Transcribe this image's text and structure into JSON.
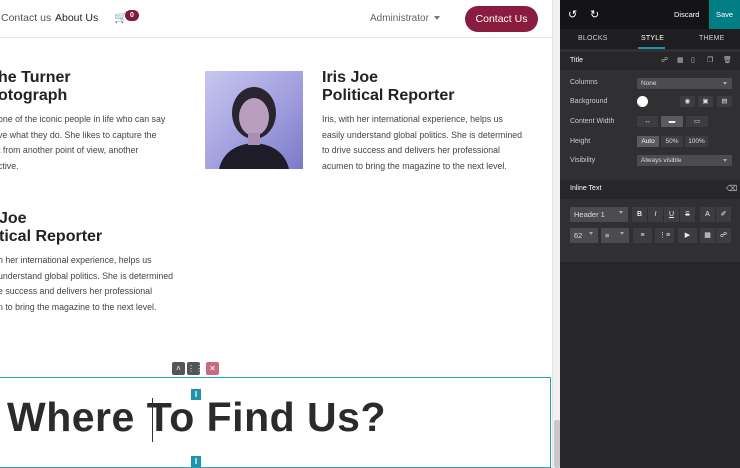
{
  "navbar": {
    "contact_link": "Contact us",
    "about_link": "About Us",
    "cart_count": "0",
    "admin_label": "Administrator",
    "contact_button": "Contact Us"
  },
  "cards": {
    "left_top": {
      "name": "he Turner",
      "role": "otograph",
      "bio": [
        "one of the iconic people in life who can say",
        "ve what they do. She likes to capture the",
        "t from another point of view, another",
        "ctive."
      ]
    },
    "right_top": {
      "name": "Iris Joe",
      "role": "Political Reporter",
      "bio": [
        "Iris, with her international experience, helps us",
        "easily understand global politics. She is determined",
        "to drive success and delivers her professional",
        "acumen to bring the magazine to the next level."
      ]
    },
    "left_bottom": {
      "name": "Joe",
      "role": "tical Reporter",
      "bio": [
        "h her international experience, helps us",
        "understand global politics. She is determined",
        "e success and delivers her professional",
        "n to bring the magazine to the next level."
      ]
    }
  },
  "heading": {
    "text": "Where To Find Us?",
    "marker": "I"
  },
  "editor": {
    "undo_icon": "undo-icon",
    "redo_icon": "redo-icon",
    "discard_label": "Discard",
    "save_label": "Save",
    "tabs": [
      "BLOCKS",
      "STYLE",
      "THEME"
    ],
    "active_tab": "STYLE",
    "title_section": "Title",
    "options": {
      "columns_label": "Columns",
      "columns_value": "None",
      "background_label": "Background",
      "content_width_label": "Content Width",
      "height_label": "Height",
      "height_options": [
        "Auto",
        "50%",
        "100%"
      ],
      "visibility_label": "Visibility",
      "visibility_value": "Always visible"
    },
    "inline_text": {
      "title": "Inline Text",
      "heading_select": "Header 1",
      "bold": "B",
      "italic": "I",
      "underline": "U",
      "strike": "S",
      "font_size": "62",
      "accent_color": "#1d94a9"
    }
  }
}
